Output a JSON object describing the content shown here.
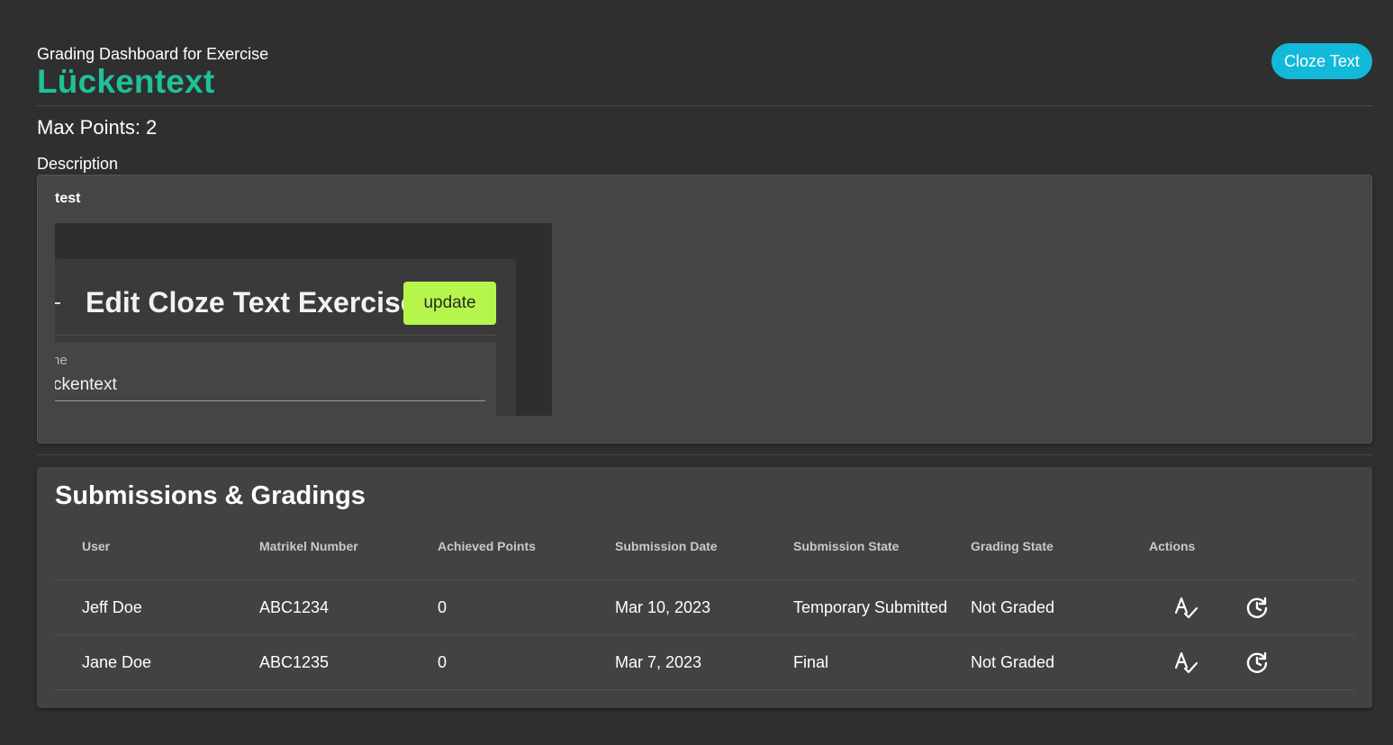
{
  "header": {
    "subtitle": "Grading Dashboard for Exercise",
    "title": "Lückentext",
    "exercise_type": "Cloze Text",
    "exercise_type_color": "#13b9d8",
    "title_color": "#1fc19a"
  },
  "max_points": {
    "label": "Max Points:",
    "value": "2"
  },
  "description": {
    "label": "Description",
    "text": "test",
    "image": {
      "heading": "Edit Cloze Text Exercise",
      "button_label": "update",
      "button_color": "#b6f54c",
      "field_label": "ne",
      "field_value": "ckentext"
    }
  },
  "submissions": {
    "title": "Submissions & Gradings",
    "columns": [
      "User",
      "Matrikel Number",
      "Achieved Points",
      "Submission Date",
      "Submission State",
      "Grading State",
      "Actions"
    ],
    "rows": [
      {
        "user": "Jeff Doe",
        "matrikel": "ABC1234",
        "points": "0",
        "date": "Mar 10, 2023",
        "submission_state": "Temporary Submitted",
        "grading_state": "Not Graded",
        "actions": [
          "spellcheck-icon",
          "history-icon"
        ]
      },
      {
        "user": "Jane Doe",
        "matrikel": "ABC1235",
        "points": "0",
        "date": "Mar 7, 2023",
        "submission_state": "Final",
        "grading_state": "Not Graded",
        "actions": [
          "spellcheck-icon",
          "history-icon"
        ]
      }
    ]
  }
}
